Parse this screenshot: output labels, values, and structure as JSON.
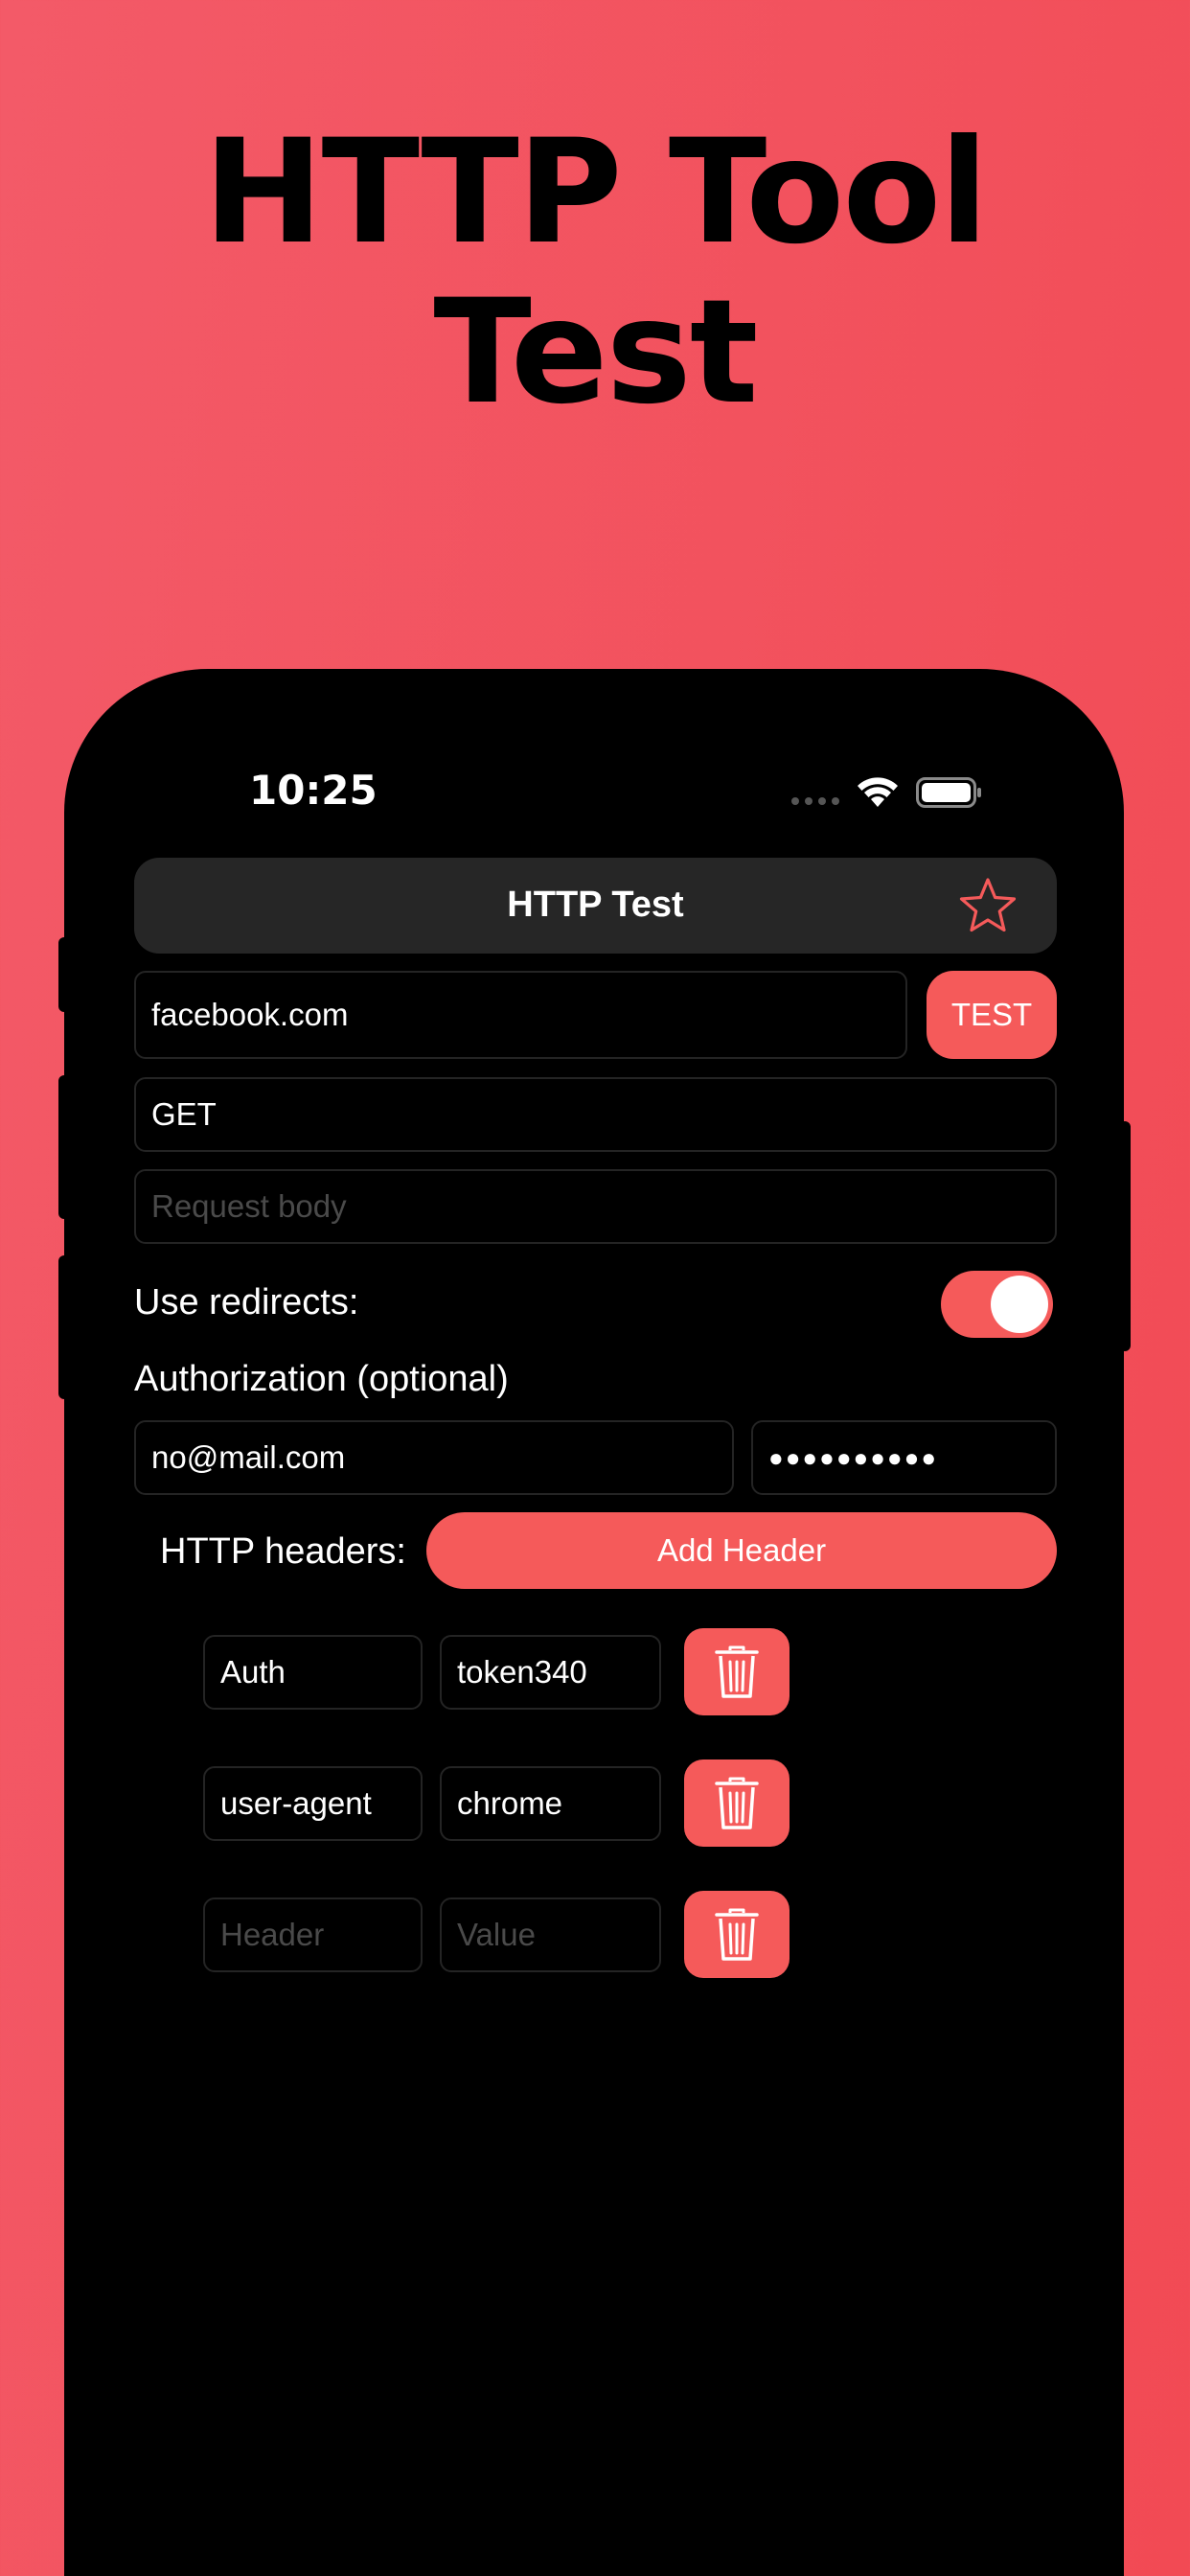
{
  "promo": {
    "title_line1": "HTTP Tool",
    "title_line2": "Test"
  },
  "status_bar": {
    "time": "10:25",
    "wifi_icon": "wifi-icon",
    "battery_icon": "battery-icon"
  },
  "nav": {
    "title": "HTTP Test",
    "favorite_icon": "star-icon"
  },
  "request": {
    "url": "facebook.com",
    "test_label": "TEST",
    "method": "GET",
    "body_placeholder": "Request body"
  },
  "redirects": {
    "label": "Use redirects:",
    "enabled": true
  },
  "authorization": {
    "label": "Authorization (optional)",
    "username": "no@mail.com",
    "password_masked": "●●●●●●●●●●"
  },
  "headers": {
    "label": "HTTP headers:",
    "add_label": "Add Header",
    "rows": [
      {
        "name": "Auth",
        "value": "token340"
      },
      {
        "name": "user-agent",
        "value": "chrome"
      },
      {
        "name_placeholder": "Header",
        "value_placeholder": "Value"
      }
    ],
    "delete_icon": "trash-icon"
  },
  "colors": {
    "accent": "#f55a5a",
    "background_gradient_start": "#f35a68",
    "background_gradient_end": "#f24a54",
    "phone_body": "#000000",
    "nav_bar": "#262626"
  }
}
